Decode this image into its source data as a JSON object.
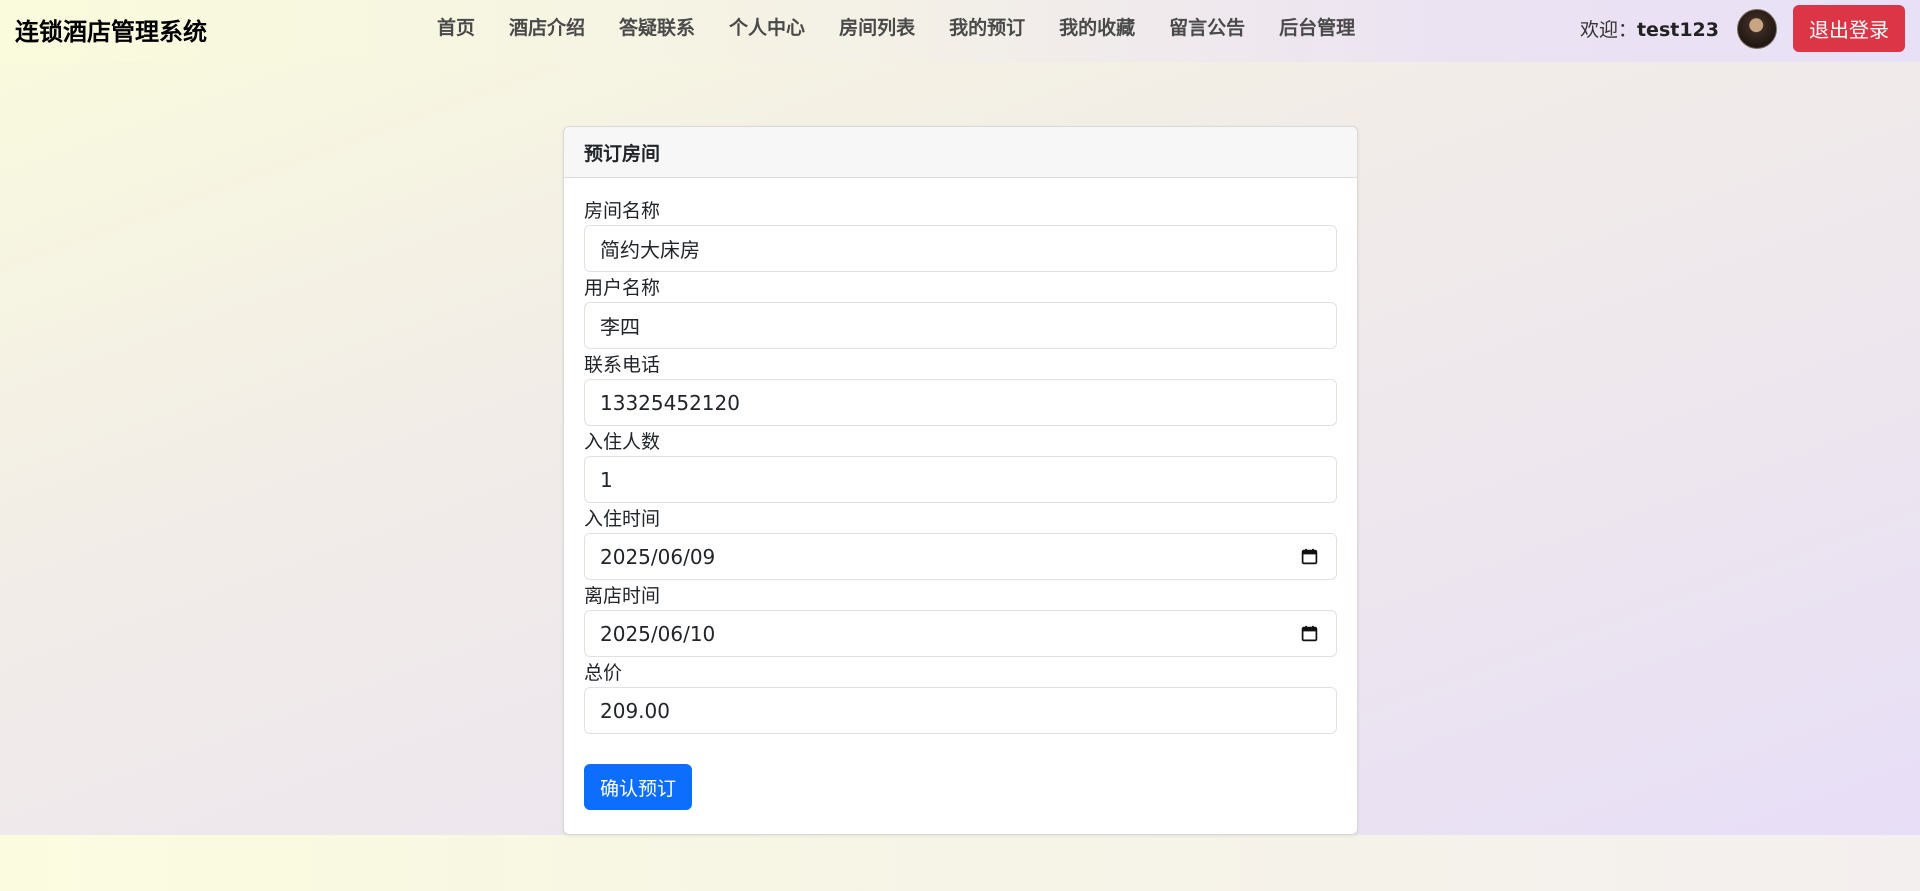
{
  "navbar": {
    "brand": "连锁酒店管理系统",
    "links": [
      "首页",
      "酒店介绍",
      "答疑联系",
      "个人中心",
      "房间列表",
      "我的预订",
      "我的收藏",
      "留言公告",
      "后台管理"
    ],
    "welcome_prefix": "欢迎：",
    "username": "test123",
    "logout_label": "退出登录"
  },
  "card": {
    "title": "预订房间",
    "fields": [
      {
        "label": "房间名称",
        "value": "简约大床房"
      },
      {
        "label": "用户名称",
        "value": "李四"
      },
      {
        "label": "联系电话",
        "value": "13325452120"
      },
      {
        "label": "入住人数",
        "value": "1"
      },
      {
        "label": "入住时间",
        "value": "2025/06/09"
      },
      {
        "label": "离店时间",
        "value": "2025/06/10"
      },
      {
        "label": "总价",
        "value": "209.00"
      }
    ],
    "submit_label": "确认预订"
  },
  "colors": {
    "logout_bg": "#dc3545",
    "submit_bg": "#0d6efd"
  },
  "icons": {
    "avatar": "user-avatar",
    "date_picker": "calendar-icon"
  }
}
